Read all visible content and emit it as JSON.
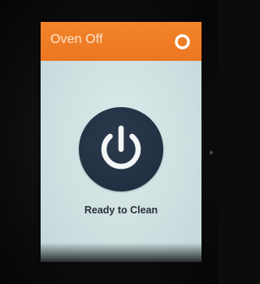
{
  "header": {
    "title": "Oven Off",
    "background_color": "#ec7622",
    "ring_icon": "ring-icon"
  },
  "main": {
    "power_icon": "power-icon",
    "power_button_color": "#223043",
    "status_text": "Ready to Clean"
  }
}
